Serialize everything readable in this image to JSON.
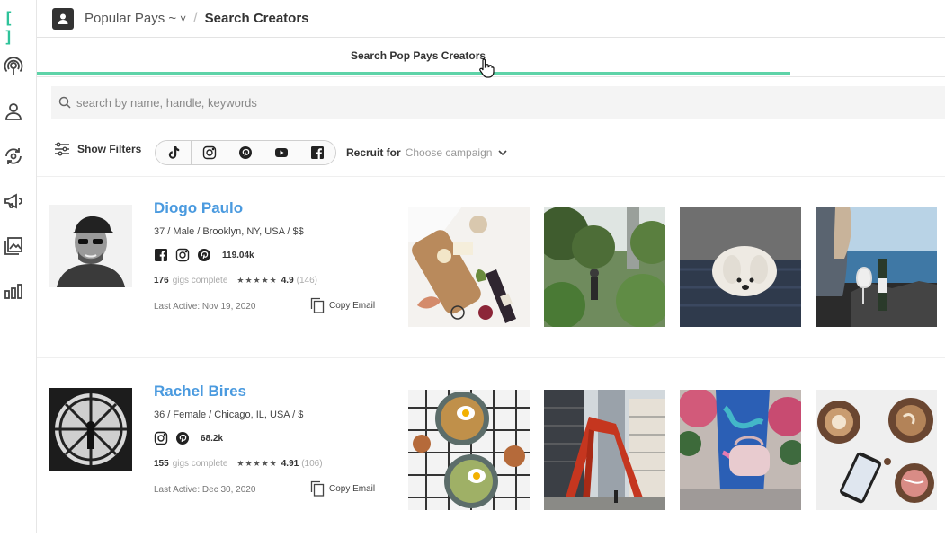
{
  "brand": {
    "logo_text": "[ ]",
    "accent": "#2ec39a"
  },
  "sidebar": {
    "items": [
      {
        "icon": "broadcast-icon"
      },
      {
        "icon": "person-icon"
      },
      {
        "icon": "refresh-eye-icon"
      },
      {
        "icon": "megaphone-icon"
      },
      {
        "icon": "gallery-icon"
      },
      {
        "icon": "bar-chart-icon"
      }
    ]
  },
  "header": {
    "org_name": "Popular Pays ~",
    "org_chevron": "˅",
    "separator": "/",
    "page_title": "Search Creators"
  },
  "tab": {
    "label": "Search Pop Pays Creators",
    "underline_color": "#5ed3a8"
  },
  "search": {
    "placeholder": "search by name, handle, keywords",
    "value": ""
  },
  "filters": {
    "show_filters_label": "Show Filters",
    "platforms": [
      "tiktok-icon",
      "instagram-icon",
      "pinterest-icon",
      "youtube-icon",
      "facebook-icon"
    ],
    "recruit_label": "Recruit for",
    "recruit_placeholder": "Choose campaign"
  },
  "creators": [
    {
      "name": "Diogo Paulo",
      "details": "37 / Male / Brooklyn, NY, USA / $$",
      "socials": [
        "facebook-icon",
        "instagram-icon",
        "pinterest-icon"
      ],
      "followers": "119.04k",
      "gigs_count": "176",
      "gigs_label": "gigs complete",
      "stars": "★★★★★",
      "rating": "4.9",
      "reviews": "(146)",
      "last_active": "Last Active: Nov 19, 2020",
      "copy_email": "Copy Email"
    },
    {
      "name": "Rachel Bires",
      "details": "36 / Female / Chicago, IL, USA / $",
      "socials": [
        "instagram-icon",
        "pinterest-icon"
      ],
      "followers": "68.2k",
      "gigs_count": "155",
      "gigs_label": "gigs complete",
      "stars": "★★★★★",
      "rating": "4.91",
      "reviews": "(106)",
      "last_active": "Last Active: Dec 30, 2020",
      "copy_email": "Copy Email"
    }
  ],
  "colors": {
    "link_blue": "#4a9adf",
    "text_dark": "#333333",
    "muted": "#999999"
  }
}
